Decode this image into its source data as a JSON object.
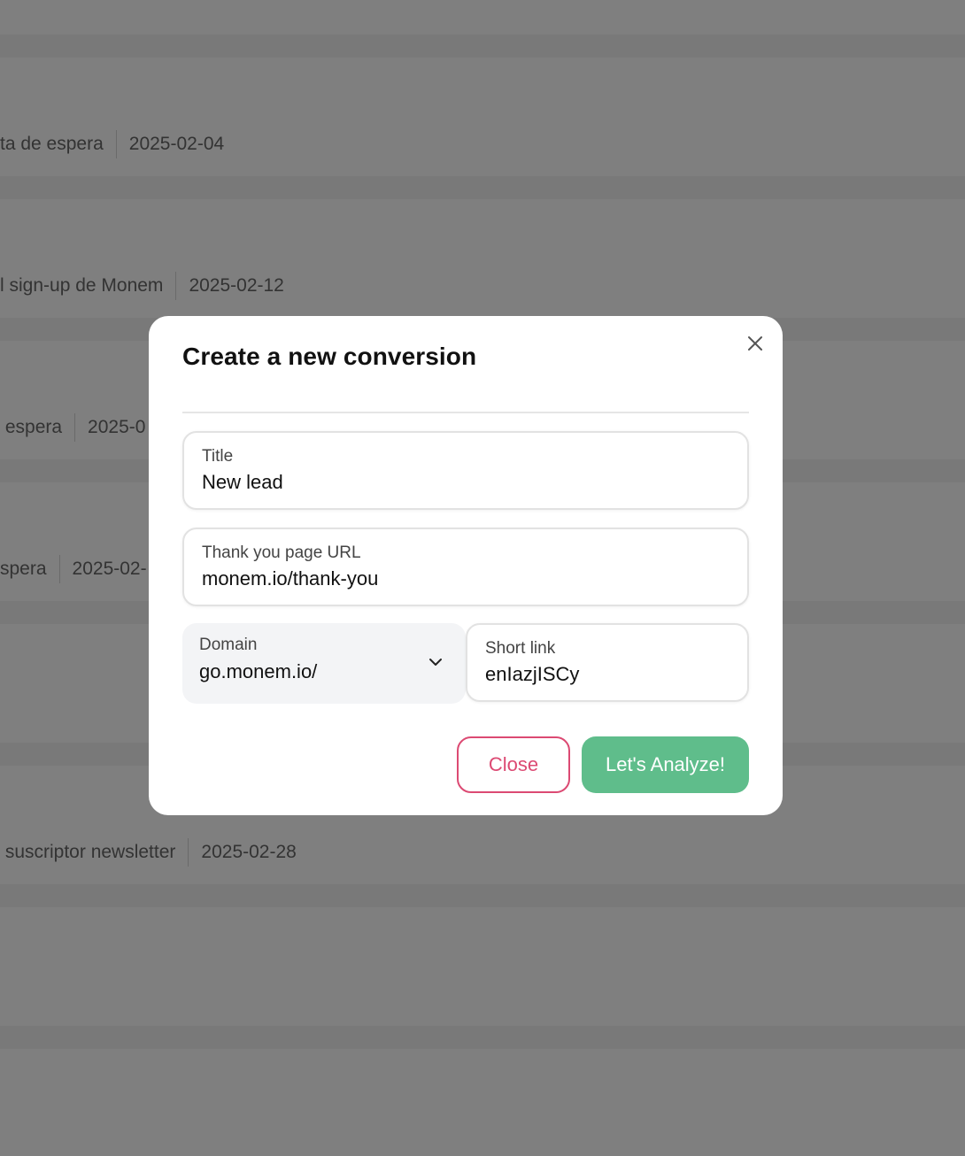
{
  "background": {
    "rows": [
      {
        "name": "ta de espera",
        "date": "2025-02-04"
      },
      {
        "name": "l sign-up de Monem",
        "date": "2025-02-12"
      },
      {
        "name": " espera",
        "date": "2025-0"
      },
      {
        "name": "spera",
        "date": "2025-02-"
      },
      {
        "name": " suscriptor newsletter",
        "date": "2025-02-28"
      }
    ]
  },
  "modal": {
    "title": "Create a new conversion",
    "close_icon": "close-icon",
    "fields": {
      "title": {
        "label": "Title",
        "value": "New lead"
      },
      "thank_you_url": {
        "label": "Thank you page URL",
        "value": "monem.io/thank-you"
      },
      "domain": {
        "label": "Domain",
        "value": "go.monem.io/",
        "icon": "chevron-down-icon"
      },
      "short_link": {
        "label": "Short link",
        "value": "enIazjISCy"
      }
    },
    "buttons": {
      "close": "Close",
      "analyze": "Let's Analyze!"
    },
    "colors": {
      "close_accent": "#dc4a73",
      "analyze_bg": "#5fbd8b",
      "domain_bg": "#f3f4f6"
    }
  }
}
